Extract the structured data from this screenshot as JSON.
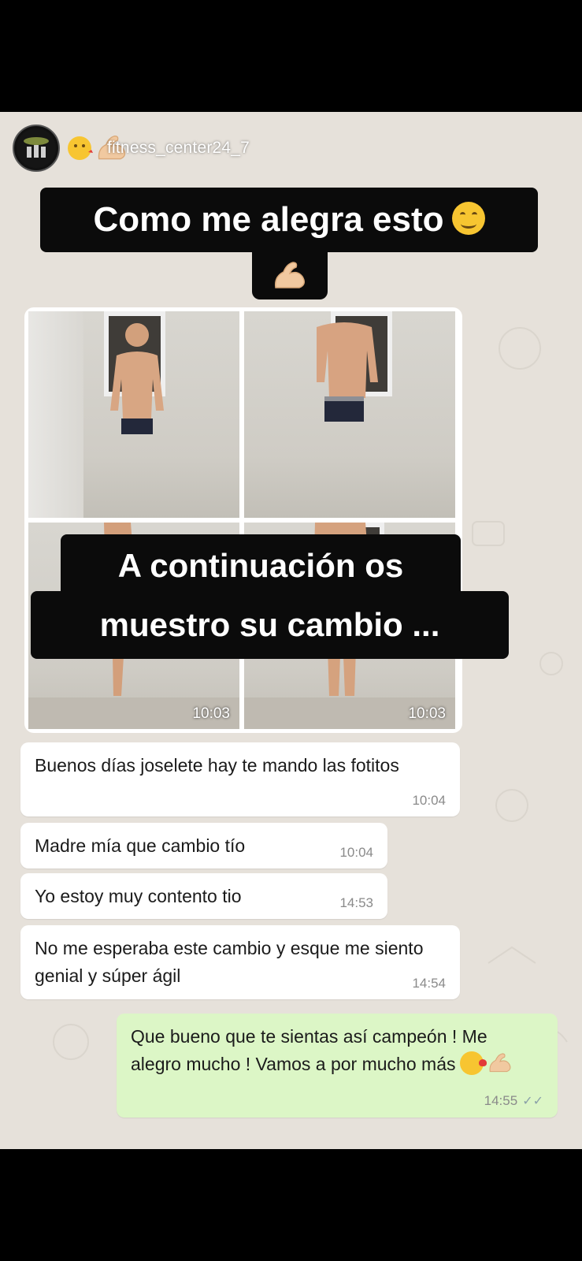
{
  "story": {
    "account": {
      "username": "fitness_center24_7",
      "avatar_icon": "gym-logo-icon"
    },
    "header_emojis": [
      "face-blowing-kiss-icon",
      "flexed-biceps-icon"
    ],
    "caption_top": "Como me alegra esto",
    "caption_top_emojis": [
      "smiling-face-icon",
      "flexed-biceps-icon"
    ],
    "caption_middle_line1": "A continuación os",
    "caption_middle_line2": "muestro su cambio ...",
    "photos": [
      {
        "timestamp": ""
      },
      {
        "timestamp": ""
      },
      {
        "timestamp": "10:03"
      },
      {
        "timestamp": "10:03"
      }
    ]
  },
  "chat": {
    "messages": [
      {
        "direction": "in",
        "text": "Buenos días joselete hay te mando las fotitos",
        "time": "10:04"
      },
      {
        "direction": "in",
        "text": "Madre mía que cambio tío",
        "time": "10:04"
      },
      {
        "direction": "in",
        "text": "Yo estoy muy contento tio",
        "time": "14:53"
      },
      {
        "direction": "in",
        "text": "No me esperaba este cambio y esque me siento genial y súper ágil",
        "time": "14:54"
      },
      {
        "direction": "out",
        "text": "Que bueno que te sientas así campeón ! Me alegro mucho ! Vamos a por mucho más",
        "time": "14:55",
        "status": "read-double-check-icon"
      }
    ]
  },
  "colors": {
    "chat_background": "#e6e1da",
    "incoming_bubble": "#ffffff",
    "outgoing_bubble": "#dcf6c6",
    "caption_background": "#0b0b0b"
  }
}
